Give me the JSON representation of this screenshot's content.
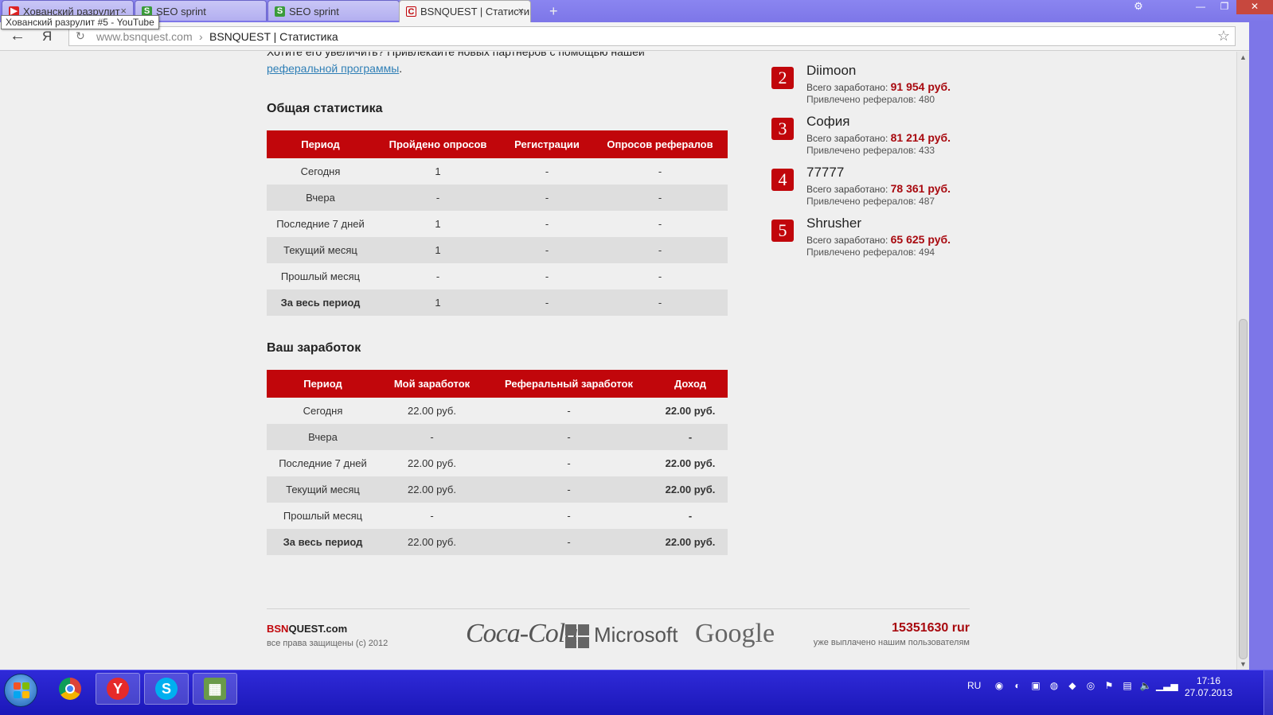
{
  "browser": {
    "tabs": [
      {
        "title": "Хованский разрулит",
        "icon": "youtube-icon"
      },
      {
        "title": "SEO sprint",
        "icon": "seosprint-icon"
      },
      {
        "title": "SEO sprint",
        "icon": "seosprint-icon"
      },
      {
        "title": "BSNQUEST | Статистик",
        "icon": "bsnquest-icon"
      }
    ],
    "tooltip": "Хованский разрулит #5 - YouTube",
    "url_host": "www.bsnquest.com",
    "url_separator": "›",
    "url_title": "BSNQUEST | Статистика",
    "ya_button": "Я"
  },
  "page": {
    "intro_line": "Хотите его увеличить? Привлекайте новых партнеров с помощью нашей",
    "intro_link": "реферальной программы",
    "intro_tail": ".",
    "general_stats": {
      "title": "Общая статистика",
      "headers": [
        "Период",
        "Пройдено опросов",
        "Регистрации",
        "Опросов рефералов"
      ],
      "rows": [
        [
          "Сегодня",
          "1",
          "-",
          "-"
        ],
        [
          "Вчера",
          "-",
          "-",
          "-"
        ],
        [
          "Последние 7 дней",
          "1",
          "-",
          "-"
        ],
        [
          "Текущий месяц",
          "1",
          "-",
          "-"
        ],
        [
          "Прошлый месяц",
          "-",
          "-",
          "-"
        ],
        [
          "За весь период",
          "1",
          "-",
          "-"
        ]
      ]
    },
    "earnings": {
      "title": "Ваш заработок",
      "headers": [
        "Период",
        "Мой заработок",
        "Реферальный заработок",
        "Доход"
      ],
      "rows": [
        [
          "Сегодня",
          "22.00 руб.",
          "-",
          "22.00 руб."
        ],
        [
          "Вчера",
          "-",
          "-",
          "-"
        ],
        [
          "Последние 7 дней",
          "22.00 руб.",
          "-",
          "22.00 руб."
        ],
        [
          "Текущий месяц",
          "22.00 руб.",
          "-",
          "22.00 руб."
        ],
        [
          "Прошлый месяц",
          "-",
          "-",
          "-"
        ],
        [
          "За весь период",
          "22.00 руб.",
          "-",
          "22.00 руб."
        ]
      ]
    },
    "leaders": [
      {
        "rank": "2",
        "name": "Diimoon",
        "earned_label": "Всего заработано:",
        "earned": "91 954 руб.",
        "ref_label": "Привлечено рефералов:",
        "refs": "480"
      },
      {
        "rank": "3",
        "name": "София",
        "earned_label": "Всего заработано:",
        "earned": "81 214 руб.",
        "ref_label": "Привлечено рефералов:",
        "refs": "433"
      },
      {
        "rank": "4",
        "name": "77777",
        "earned_label": "Всего заработано:",
        "earned": "78 361 руб.",
        "ref_label": "Привлечено рефералов:",
        "refs": "487"
      },
      {
        "rank": "5",
        "name": "Shrusher",
        "earned_label": "Всего заработано:",
        "earned": "65 625 руб.",
        "ref_label": "Привлечено рефералов:",
        "refs": "494"
      }
    ],
    "footer": {
      "brand_red": "BSN",
      "brand_rest": "QUEST.com",
      "copyright": "все права защищены (с) 2012",
      "partner_logos": [
        "Coca-Cola",
        "Microsoft",
        "Google"
      ],
      "total_paid": "15351630 rur",
      "total_paid_label": "уже выплачено нашим пользователям"
    }
  },
  "taskbar": {
    "apps": [
      "chrome-icon",
      "yandex-browser-icon",
      "skype-icon",
      "minecraft-icon"
    ],
    "language": "RU",
    "time": "17:16",
    "date": "27.07.2013"
  },
  "colors": {
    "accent_red": "#c1060b",
    "taskbar_blue": "#1b17b8",
    "tabstrip_purple": "#7d76e8"
  }
}
